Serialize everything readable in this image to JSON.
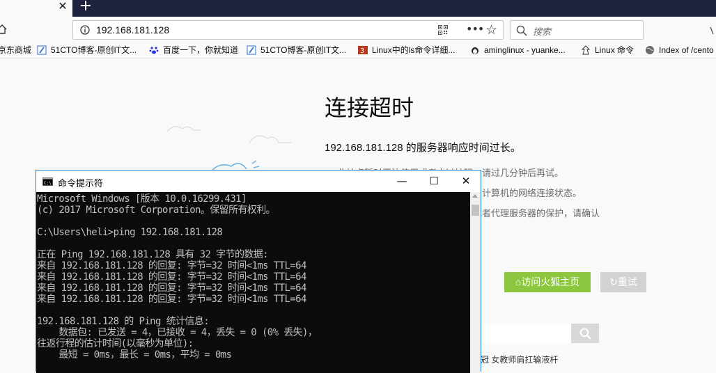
{
  "browser": {
    "url": "192.168.181.128",
    "search_placeholder": "搜索",
    "tab_close_glyph": "✕",
    "new_tab_glyph": "+",
    "page_actions_glyph": "•••",
    "bookmark_glyph": "☆"
  },
  "bookmarks": [
    {
      "label": "京东商城",
      "icon": "jd-icon"
    },
    {
      "label": "51CTO博客-原创IT文...",
      "icon": "bookmark-51cto-icon"
    },
    {
      "label": "百度一下，你就知道",
      "icon": "baidu-paw-icon"
    },
    {
      "label": "51CTO博客-原创IT文...",
      "icon": "bookmark-51cto-icon"
    },
    {
      "label": "Linux中的ls命令详细...",
      "icon": "cnblogs-icon"
    },
    {
      "label": "aminglinux - yuanke...",
      "icon": "tux-icon"
    },
    {
      "label": "Linux 命令",
      "icon": "linux-cmd-icon"
    },
    {
      "label": "Index of /cento",
      "icon": "globe-icon"
    }
  ],
  "error_page": {
    "title": "连接超时",
    "description": "192.168.181.128 的服务器响应时间过长。",
    "suggestions": [
      "此站点暂时无法使用或者太过忙碌。请过几分钟后再试。",
      "如果您无法载入任何网页，请检查您计算机的网络连接状态。",
      "如果您的计算机或网络受到防火墙或者代理服务器的保护，请确认"
    ],
    "home_button": "访问火狐主页",
    "retry_button": "重试",
    "news_text": "冠  女教师肩扛输液杆"
  },
  "cmd_window": {
    "title": "命令提示符",
    "minimize": "—",
    "maximize": "☐",
    "close": "✕",
    "lines": [
      "Microsoft Windows [版本 10.0.16299.431]",
      "(c) 2017 Microsoft Corporation。保留所有权利。",
      "",
      "C:\\Users\\heli>ping 192.168.181.128",
      "",
      "正在 Ping 192.168.181.128 具有 32 字节的数据:",
      "来自 192.168.181.128 的回复: 字节=32 时间<1ms TTL=64",
      "来自 192.168.181.128 的回复: 字节=32 时间<1ms TTL=64",
      "来自 192.168.181.128 的回复: 字节=32 时间<1ms TTL=64",
      "来自 192.168.181.128 的回复: 字节=32 时间<1ms TTL=64",
      "",
      "192.168.181.128 的 Ping 统计信息:",
      "    数据包: 已发送 = 4，已接收 = 4，丢失 = 0 (0% 丢失)，",
      "往返行程的估计时间(以毫秒为单位):",
      "    最短 = 0ms，最长 = 0ms，平均 = 0ms"
    ]
  },
  "colors": {
    "tabstrip": "#202340",
    "home_button": "#8dc73f",
    "cmd_border": "#1979ca",
    "terminal_bg": "#0c0c0c",
    "terminal_fg": "#c0c0c0"
  }
}
